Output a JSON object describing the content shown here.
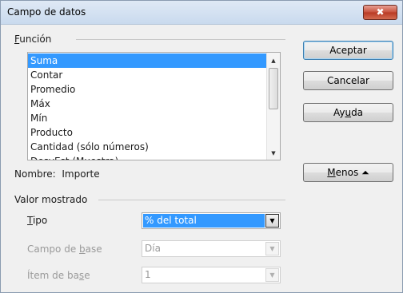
{
  "window": {
    "title": "Campo de datos",
    "close_label": "✖"
  },
  "function_group": {
    "label_prefix": "",
    "label_mnemonic": "F",
    "label_rest": "unción",
    "items": [
      "Suma",
      "Contar",
      "Promedio",
      "Máx",
      "Mín",
      "Producto",
      "Cantidad (sólo números)",
      "DesvEst (Muestra)"
    ],
    "selected_index": 0
  },
  "name_row": {
    "label": "Nombre:",
    "value": "Importe"
  },
  "displayed_value_group": {
    "label": "Valor mostrado",
    "type": {
      "label_mnemonic": "T",
      "label_rest": "ipo",
      "value": "% del total"
    },
    "base_field": {
      "label_prefix": "Campo de ",
      "label_mnemonic": "b",
      "label_rest": "ase",
      "value": "Día"
    },
    "base_item": {
      "label_prefix": "Ítem de ba",
      "label_mnemonic": "s",
      "label_rest": "e",
      "value": "1"
    }
  },
  "buttons": {
    "accept": "Aceptar",
    "cancel": "Cancelar",
    "help_prefix": "Ay",
    "help_mnemonic": "u",
    "help_rest": "da",
    "less_mnemonic": "M",
    "less_rest": "enos",
    "less_icon": "⏶"
  },
  "icons": {
    "scroll_up": "▲",
    "scroll_down": "▼",
    "dropdown": "▼"
  }
}
